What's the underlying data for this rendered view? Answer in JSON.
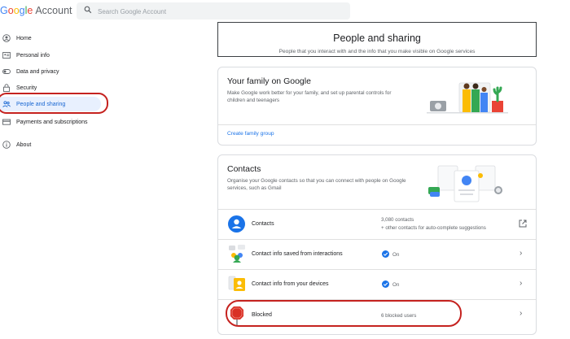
{
  "header": {
    "logo_letters": [
      "G",
      "o",
      "o",
      "g",
      "l",
      "e"
    ],
    "logo_suffix": "Account",
    "search_placeholder": "Search Google Account"
  },
  "sidebar": {
    "items": [
      {
        "label": "Home",
        "icon": "person-circle-icon"
      },
      {
        "label": "Personal info",
        "icon": "id-card-icon"
      },
      {
        "label": "Data and privacy",
        "icon": "toggle-icon"
      },
      {
        "label": "Security",
        "icon": "lock-icon"
      },
      {
        "label": "People and sharing",
        "icon": "people-icon",
        "active": true
      },
      {
        "label": "Payments and subscriptions",
        "icon": "credit-card-icon"
      },
      {
        "label": "About",
        "icon": "info-icon"
      }
    ]
  },
  "page": {
    "title": "People and sharing",
    "subtitle": "People that you interact with and the info that you make visible on Google services"
  },
  "family": {
    "title": "Your family on Google",
    "description": "Make Google work better for your family, and set up parental controls for children and teenagers",
    "link": "Create family group"
  },
  "contacts": {
    "title": "Contacts",
    "description": "Organise your Google contacts so that you can connect with people on Google services, such as Gmail",
    "rows": [
      {
        "label": "Contacts",
        "value_line1": "3,080 contacts",
        "value_line2": "+ other contacts for auto-complete suggestions",
        "action": "open-external-icon"
      },
      {
        "label": "Contact info saved from interactions",
        "value_line1": "On",
        "action": "chevron-right-icon"
      },
      {
        "label": "Contact info from your devices",
        "value_line1": "On",
        "action": "chevron-right-icon"
      },
      {
        "label": "Blocked",
        "value_line1": "6 blocked users",
        "action": "chevron-right-icon"
      }
    ]
  },
  "colors": {
    "accent": "#1a73e8",
    "active_bg": "#e8f0fe",
    "annotation_red": "#c5221f"
  }
}
